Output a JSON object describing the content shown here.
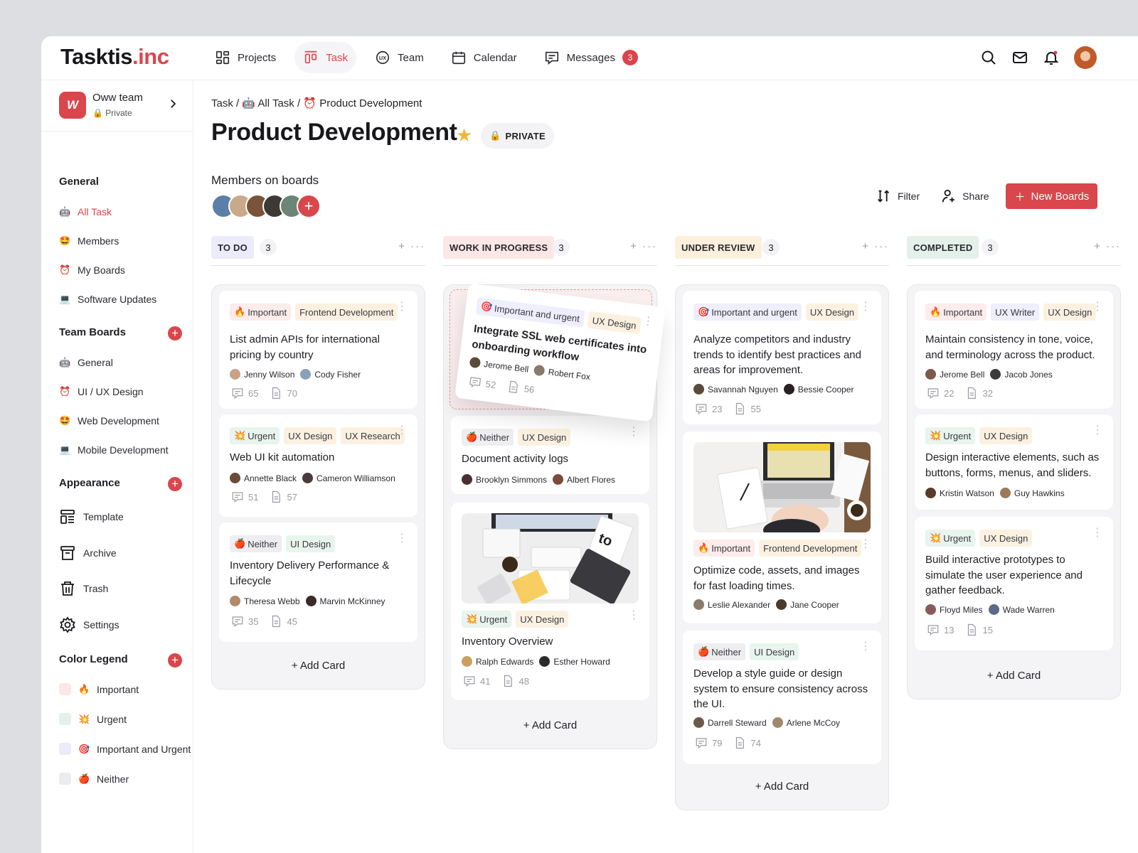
{
  "app": {
    "logo_main": "Tasktis",
    "logo_suffix": ".inc"
  },
  "nav": [
    {
      "label": "Projects",
      "icon": "grid-icon"
    },
    {
      "label": "Task",
      "icon": "task-board-icon",
      "active": true
    },
    {
      "label": "Team",
      "icon": "ux-icon"
    },
    {
      "label": "Calendar",
      "icon": "calendar-icon"
    },
    {
      "label": "Messages",
      "icon": "message-icon",
      "badge": "3"
    }
  ],
  "team": {
    "name": "Oww team",
    "privacy": "Private",
    "logo": "W"
  },
  "sidebar": {
    "general_h": "General",
    "general": [
      "All Task",
      "Members",
      "My Boards",
      "Software Updates"
    ],
    "team_boards_h": "Team Boards",
    "team_boards": [
      "General",
      "UI / UX Design",
      "Web Development",
      "Mobile Development"
    ],
    "appearance_h": "Appearance",
    "appearance": [
      "Template",
      "Archive",
      "Trash",
      "Settings"
    ],
    "legend_h": "Color Legend",
    "legend": [
      "Important",
      "Urgent",
      "Important and Urgent",
      "Neither"
    ]
  },
  "breadcrumb": {
    "a": "Task",
    "b": "All Task",
    "c": "Product Development",
    "sep": "/"
  },
  "title": "Product Development",
  "privacy_pill": "PRIVATE",
  "members_h": "Members on boards",
  "actions": {
    "filter": "Filter",
    "share": "Share",
    "new_boards": "New Boards"
  },
  "add_card": "+ Add Card",
  "colors": {
    "accent": "#d9464b",
    "star": "#f2b53b"
  },
  "columns": [
    {
      "title": "TO DO",
      "count": "3",
      "cards": [
        {
          "tags": [
            "Important",
            "Frontend Development"
          ],
          "title": "List admin APIs for international pricing by country",
          "people": [
            "Jenny Wilson",
            "Cody Fisher"
          ],
          "comments": "65",
          "files": "70"
        },
        {
          "tags": [
            "Urgent",
            "UX Design",
            "UX Research"
          ],
          "title": "Web UI kit automation",
          "people": [
            "Annette Black",
            "Cameron Williamson"
          ],
          "comments": "51",
          "files": "57"
        },
        {
          "tags": [
            "Neither",
            "UI Design"
          ],
          "title": "Inventory Delivery Performance & Lifecycle",
          "people": [
            "Theresa Webb",
            "Marvin McKinney"
          ],
          "comments": "35",
          "files": "45"
        }
      ]
    },
    {
      "title": "WORK IN PROGRESS",
      "count": "3",
      "cards": [
        {
          "tags": [
            "Important and urgent",
            "UX Design"
          ],
          "title": "Integrate SSL web certificates into onboarding workflow",
          "people": [
            "Jerome Bell",
            "Robert Fox"
          ],
          "comments": "52",
          "files": "56"
        },
        {
          "tags": [
            "Neither",
            "UX Design"
          ],
          "title": "Document activity logs",
          "people": [
            "Brooklyn Simmons",
            "Albert Flores"
          ]
        },
        {
          "tags": [
            "Urgent",
            "UX Design"
          ],
          "title": "Inventory Overview",
          "people": [
            "Ralph Edwards",
            "Esther Howard"
          ],
          "comments": "41",
          "files": "48"
        }
      ]
    },
    {
      "title": "UNDER REVIEW",
      "count": "3",
      "cards": [
        {
          "tags": [
            "Important and urgent",
            "UX Design"
          ],
          "title": "Analyze competitors and industry trends to identify best practices and areas for improvement.",
          "people": [
            "Savannah Nguyen",
            "Bessie Cooper"
          ],
          "comments": "23",
          "files": "55"
        },
        {
          "tags": [
            "Important",
            "Frontend Development"
          ],
          "title": "Optimize code, assets, and images for fast loading times.",
          "people": [
            "Leslie Alexander",
            "Jane Cooper"
          ]
        },
        {
          "tags": [
            "Neither",
            "UI Design"
          ],
          "title": "Develop a style guide or design system to ensure consistency across the UI.",
          "people": [
            "Darrell Steward",
            "Arlene McCoy"
          ],
          "comments": "79",
          "files": "74"
        }
      ]
    },
    {
      "title": "COMPLETED",
      "count": "3",
      "cards": [
        {
          "tags": [
            "Important",
            "UX Writer",
            "UX Design"
          ],
          "title": "Maintain consistency in tone, voice, and terminology across the product.",
          "people": [
            "Jerome Bell",
            "Jacob Jones"
          ],
          "comments": "22",
          "files": "32"
        },
        {
          "tags": [
            "Urgent",
            "UX Design"
          ],
          "title": "Design interactive elements, such as buttons, forms, menus, and sliders.",
          "people": [
            "Kristin Watson",
            "Guy Hawkins"
          ]
        },
        {
          "tags": [
            "Urgent",
            "UX Design"
          ],
          "title": "Build interactive prototypes to simulate the user experience and gather feedback.",
          "people": [
            "Floyd Miles",
            "Wade Warren"
          ],
          "comments": "13",
          "files": "15"
        }
      ]
    }
  ]
}
